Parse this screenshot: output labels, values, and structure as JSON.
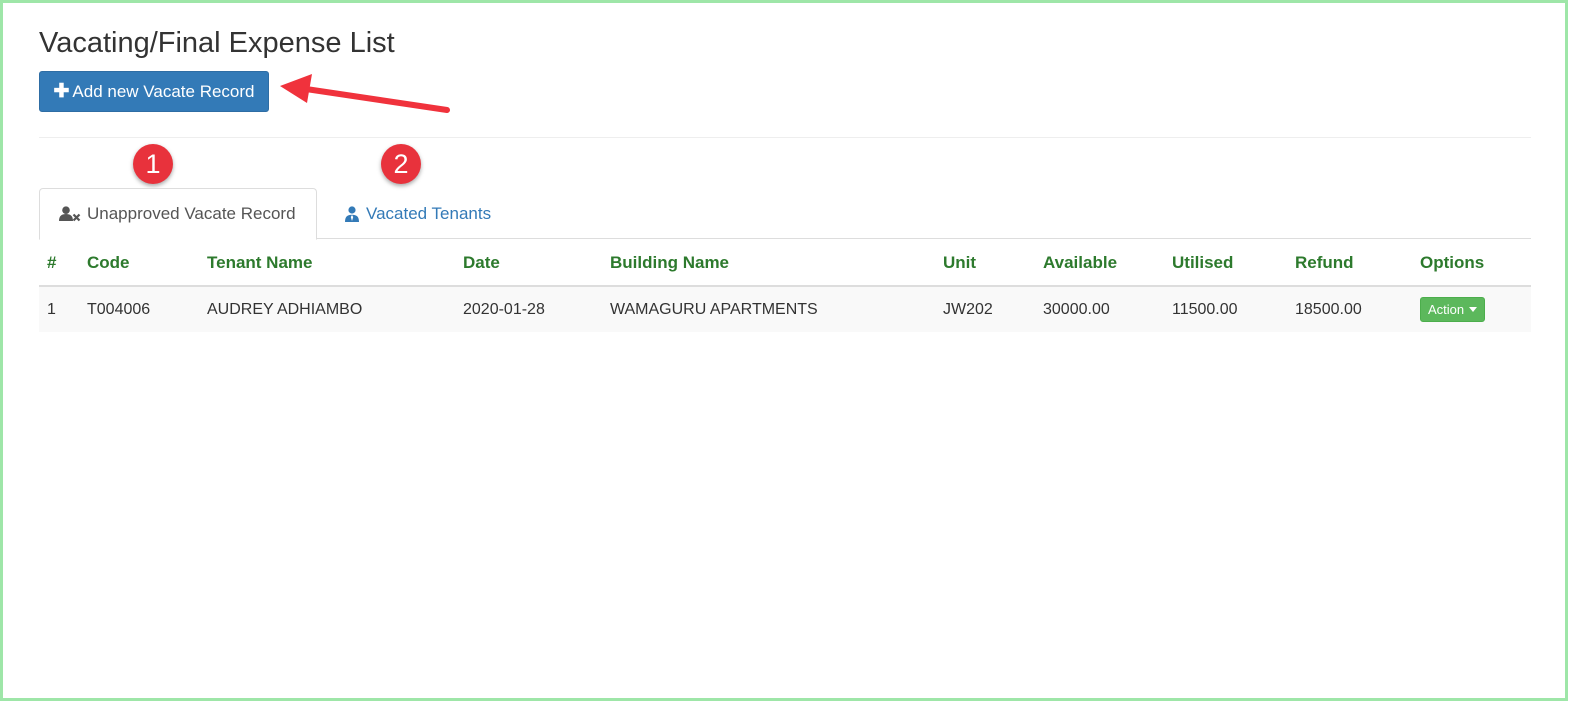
{
  "page": {
    "title": "Vacating/Final Expense List",
    "add_button": {
      "icon": "plus-icon",
      "label": "Add new Vacate Record"
    }
  },
  "annotations": {
    "badge_1": "1",
    "badge_2": "2",
    "arrow_color": "#f0323c"
  },
  "tabs": [
    {
      "label": "Unapproved Vacate Record",
      "icon": "user-times-icon",
      "active": true
    },
    {
      "label": "Vacated Tenants",
      "icon": "user-tie-icon",
      "active": false
    }
  ],
  "table": {
    "columns": [
      "#",
      "Code",
      "Tenant Name",
      "Date",
      "Building Name",
      "Unit",
      "Available",
      "Utilised",
      "Refund",
      "Options"
    ],
    "rows": [
      {
        "num": "1",
        "code": "T004006",
        "tenant_name": "AUDREY ADHIAMBO",
        "date": "2020-01-28",
        "building_name": "WAMAGURU APARTMENTS",
        "unit": "JW202",
        "available": "30000.00",
        "utilised": "11500.00",
        "refund": "18500.00",
        "action_label": "Action"
      }
    ]
  },
  "colors": {
    "primary": "#337ab7",
    "success": "#5cb85c",
    "header_text": "#2d7a2d",
    "badge": "#e8323c"
  }
}
